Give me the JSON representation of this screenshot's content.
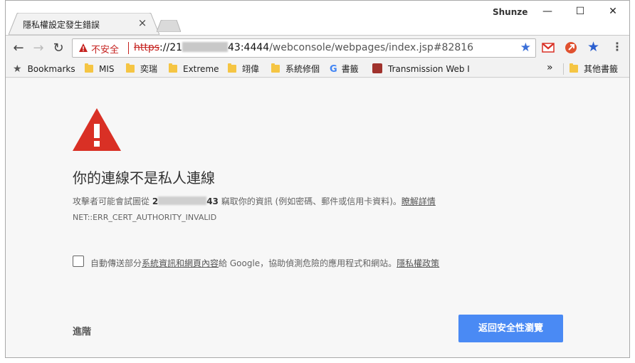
{
  "browser": {
    "tab_title": "隱私權設定發生錯誤",
    "tab_close": "×",
    "user_name": "Shunze",
    "window_controls": {
      "minimize": "—",
      "maximize": "☐",
      "close": "✕"
    },
    "security_label": "不安全",
    "url": {
      "scheme": "https",
      "host_start": "://21",
      "host_end": "43:4444",
      "path": "/webconsole/webpages/index.jsp#82816"
    },
    "nav": {
      "back": "←",
      "forward": "→",
      "reload": "↻"
    },
    "bookmarks": [
      {
        "label": "Bookmarks",
        "icon": "star-icon"
      },
      {
        "label": "MIS",
        "icon": "folder-icon"
      },
      {
        "label": "奕瑞",
        "icon": "folder-icon"
      },
      {
        "label": "Extreme",
        "icon": "folder-icon"
      },
      {
        "label": "翊偉",
        "icon": "folder-icon"
      },
      {
        "label": "系統修個",
        "icon": "folder-icon"
      },
      {
        "label": "書籤",
        "icon": "google-icon"
      },
      {
        "label": "Transmission Web I",
        "icon": "transmission-icon"
      }
    ],
    "bookmarks_overflow": "»",
    "other_bookmarks": "其他書籤"
  },
  "page": {
    "heading": "你的連線不是私人連線",
    "desc_prefix": "攻擊者可能會試圖從 ",
    "desc_host_start": "2",
    "desc_host_end": "43",
    "desc_suffix": " 竊取你的資訊 (例如密碼、郵件或信用卡資料)。",
    "learn_more": "瞭解詳情",
    "error_code": "NET::ERR_CERT_AUTHORITY_INVALID",
    "checkbox_prefix": "自動傳送部分",
    "checkbox_link": "系統資訊和網頁內容",
    "checkbox_middle": "給 Google，協助偵測危險的應用程式和網站。",
    "privacy_link": "隱私權政策",
    "advanced_label": "進階",
    "back_button": "返回安全性瀏覽"
  },
  "colors": {
    "accent_blue": "#4a8af4",
    "danger_red": "#d93025",
    "background": "#f7f7f7"
  }
}
